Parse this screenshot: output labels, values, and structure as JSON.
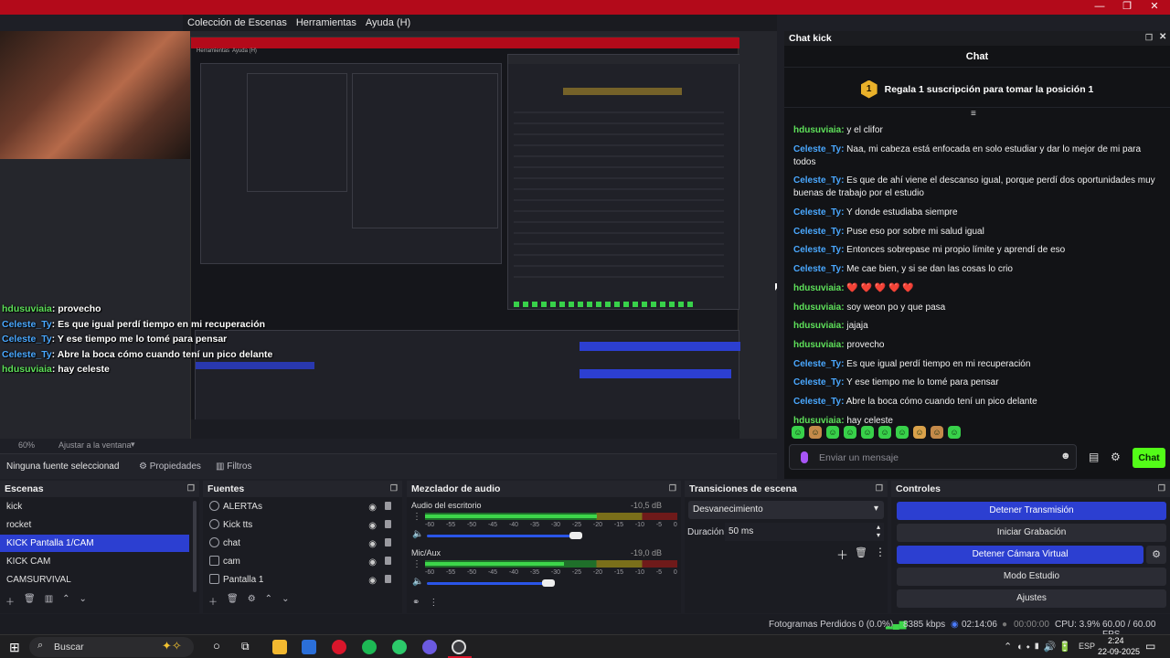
{
  "menu": {
    "items": [
      "Colección de Escenas",
      "Herramientas",
      "Ayuda (H)"
    ]
  },
  "nested_menu": [
    "Herramientas",
    "Ayuda (H)"
  ],
  "window_controls": {
    "minimize": "—",
    "restore": "❐",
    "close": "✕"
  },
  "overlay_chat": [
    {
      "user": "hdusuviaia",
      "text": ": provecho",
      "color": "g"
    },
    {
      "user": "Celeste_Ty",
      "text": ": Es que igual perdí tiempo en mi recuperación",
      "color": "c"
    },
    {
      "user": "Celeste_Ty",
      "text": ": Y ese tiempo me lo tomé para pensar",
      "color": "c"
    },
    {
      "user": "Celeste_Ty",
      "text": ": Abre la boca cómo cuando tení un pico delante",
      "color": "c"
    },
    {
      "user": "hdusuviaia",
      "text": ": hay celeste",
      "color": "g"
    }
  ],
  "zoom": {
    "value": "60%",
    "fit_label": "Ajustar a la ventana"
  },
  "props_bar": {
    "no_source": "Ninguna fuente seleccionad",
    "properties": "Propiedades",
    "filters": "Filtros"
  },
  "chat_dock": {
    "title": "Chat kick",
    "tab": "Chat",
    "pinned": {
      "rank": "1",
      "text": "Regala 1 suscripción para tomar la posición 1"
    },
    "messages": [
      {
        "user": "hdusuviaia:",
        "text": " y el clifor",
        "color": "g"
      },
      {
        "user": "Celeste_Ty:",
        "text": " Naa, mi cabeza está enfocada en solo estudiar y dar lo mejor de mi para todos",
        "color": "c"
      },
      {
        "user": "Celeste_Ty:",
        "text": " Es que de ahí viene el descanso igual, porque perdí dos oportunidades muy buenas de trabajo por el estudio",
        "color": "c"
      },
      {
        "user": "Celeste_Ty:",
        "text": " Y donde estudiaba siempre",
        "color": "c"
      },
      {
        "user": "Celeste_Ty:",
        "text": " Puse eso por sobre mi salud igual",
        "color": "c"
      },
      {
        "user": "Celeste_Ty:",
        "text": " Entonces sobrepase mi propio límite y aprendí de eso",
        "color": "c"
      },
      {
        "user": "Celeste_Ty:",
        "text": " Me cae bien, y si se dan las cosas lo crio",
        "color": "c"
      },
      {
        "user": "hdusuviaia:",
        "text": " ❤️ ❤️ ❤️ ❤️ ❤️",
        "color": "g"
      },
      {
        "user": "hdusuviaia:",
        "text": " soy weon po y que pasa",
        "color": "g"
      },
      {
        "user": "hdusuviaia:",
        "text": " jajaja",
        "color": "g"
      },
      {
        "user": "hdusuviaia:",
        "text": " provecho",
        "color": "g"
      },
      {
        "user": "Celeste_Ty:",
        "text": " Es que igual perdí tiempo en mi recuperación",
        "color": "c"
      },
      {
        "user": "Celeste_Ty:",
        "text": " Y ese tiempo me lo tomé para pensar",
        "color": "c"
      },
      {
        "user": "Celeste_Ty:",
        "text": " Abre la boca cómo cuando tení un pico delante",
        "color": "c"
      },
      {
        "user": "hdusuviaia:",
        "text": " hay celeste",
        "color": "g"
      }
    ],
    "input_placeholder": "Enviar un mensaje",
    "send_label": "Chat"
  },
  "scenes": {
    "title": "Escenas",
    "items": [
      "kick",
      "rocket",
      "KICK  Pantalla 1/CAM",
      "KICK  CAM",
      "CAMSURVIVAL"
    ],
    "selected": 2
  },
  "sources": {
    "title": "Fuentes",
    "items": [
      "ALERTAs",
      "Kick tts",
      "chat",
      "cam",
      "Pantalla 1"
    ]
  },
  "mixer": {
    "title": "Mezclador de audio",
    "channels": [
      {
        "name": "Audio del escritorio",
        "db": "-10,5 dB",
        "level": 0.68,
        "volume": 0.93
      },
      {
        "name": "Mic/Aux",
        "db": "-19,0 dB",
        "level": 0.55,
        "volume": 0.76
      }
    ],
    "scale": [
      "-60",
      "-55",
      "-50",
      "-45",
      "-40",
      "-35",
      "-30",
      "-25",
      "-20",
      "-15",
      "-10",
      "-5",
      "0"
    ]
  },
  "transitions": {
    "title": "Transiciones de escena",
    "selected": "Desvanecimiento",
    "duration_label": "Duración",
    "duration_value": "50 ms"
  },
  "controls": {
    "title": "Controles",
    "buttons": [
      {
        "label": "Detener Transmisión",
        "active": true
      },
      {
        "label": "Iniciar Grabación",
        "active": false
      },
      {
        "label": "Detener Cámara Virtual",
        "active": true
      },
      {
        "label": "Modo Estudio",
        "active": false
      },
      {
        "label": "Ajustes",
        "active": false
      }
    ]
  },
  "status": {
    "dropped": "Fotogramas Perdidos 0 (0.0%)",
    "kbps": "8385 kbps",
    "stream_time": "02:14:06",
    "rec_time": "00:00:00",
    "cpu": "CPU: 3.9%",
    "fps": "60.00 / 60.00 FPS"
  },
  "taskbar": {
    "search": "Buscar",
    "lang": "ESP",
    "time": "2:24",
    "date": "22-09-2025"
  },
  "colors": {
    "accent_blue": "#2c3fd1",
    "kick_green": "#53fc18",
    "title_red": "#b30a1a"
  }
}
